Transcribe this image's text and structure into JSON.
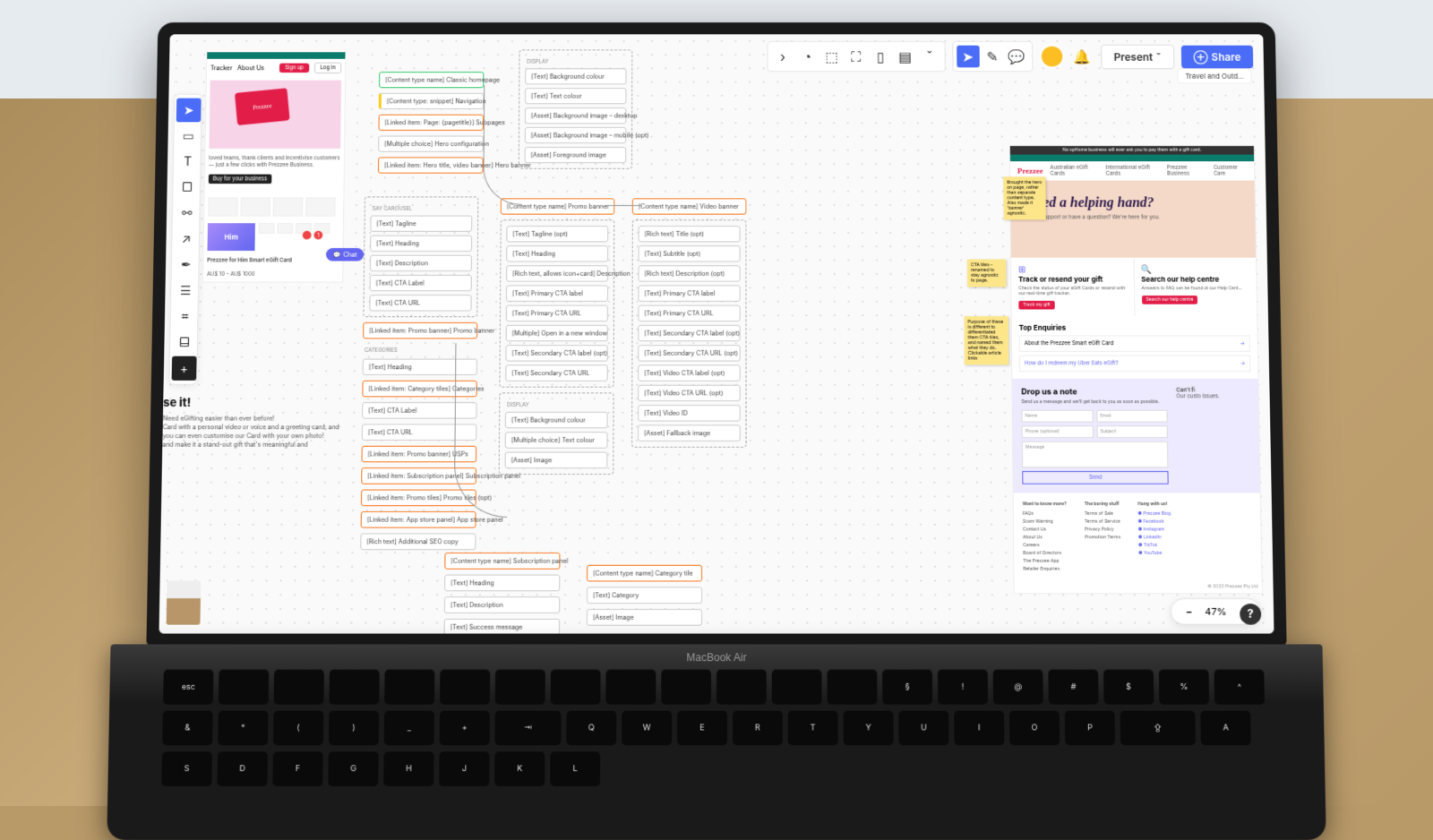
{
  "topbar": {
    "present": "Present",
    "share": "Share"
  },
  "breadcrumb": "Travel and Outd...",
  "zoom": "47%",
  "leftMockup": {
    "tracker": "Tracker",
    "aboutUs": "About Us",
    "signup": "Sign up",
    "login": "Log in",
    "logoText": "Prezzee",
    "heroText": "loved teams, thank clients and incentivise customers — just a few clicks with Prezzee Business.",
    "heroCTA": "Buy for your business",
    "prodTitle": "Prezzee for Him Smart eGift Card",
    "prodPrice": "AU$ 10 – AU$ 1000",
    "him": "Him",
    "chat": "Chat"
  },
  "giftBlock": {
    "heading": "se it!",
    "body1": "Need eGifting easier than ever before!",
    "body2": "Card with a personal video or voice and a greeting card, and you can even customise our Card with your own photo!",
    "body3": "and make it a stand-out gift that's meaningful and"
  },
  "c1": {
    "classic": "[Content type name] Classic homepage",
    "nav": "[Content type: snippet] Navigation",
    "subpages": "[Linked item: Page: {pagetitle}] Subpages",
    "heroConf": "[Multiple choice] Hero configuration",
    "heroBanner": "[Linked item: Hero title, video banner] Hero banner"
  },
  "c2": {
    "carousel": "SAY CAROUSEL",
    "tagline": "[Text] Tagline",
    "heading": "[Text] Heading",
    "desc": "[Text] Description",
    "ctaLabel": "[Text] CTA Label",
    "ctaUrl": "[Text] CTA URL",
    "promoBanner": "[Linked item: Promo banner] Promo banner",
    "categories": "CATEGORIES",
    "heading2": "[Text] Heading",
    "catTiles": "[Linked item: Category tiles] Categories",
    "ctaLabel2": "[Text] CTA Label",
    "ctaUrl2": "[Text] CTA URL",
    "usps": "[Linked item: Promo banner] USPs",
    "subPanel": "[Linked item: Subscription panel] Subscription panel",
    "promoTiles": "[Linked item: Promo tiles] Promo tiles (opt)",
    "appStore": "[Linked item: App store panel] App store panel",
    "seo": "[Rich text] Additional SEO copy"
  },
  "c3": {
    "display": "DISPLAY",
    "bgColor": "[Text] Background colour",
    "textColor": "[Text] Text colour",
    "bgDesktop": "[Asset] Background image – desktop",
    "bgMobile": "[Asset] Background image – mobile (opt)",
    "fgImage": "[Asset] Foreground image",
    "promoBanner": "[Content type name] Promo banner",
    "tagline": "[Text] Tagline (opt)",
    "heading": "[Text] Heading",
    "desc": "[Rich text, allows icon+card] Description",
    "primaryCtaLabel": "[Text] Primary CTA label",
    "primaryCtaUrl": "[Text] Primary CTA URL",
    "newWindow": "[Multiple] Open in a new window",
    "secCtaLabel": "[Text] Secondary CTA label (opt)",
    "secCtaUrl": "[Text] Secondary CTA URL",
    "display2": "DISPLAY",
    "bgColor2": "[Text] Background colour",
    "textColor2": "[Multiple choice] Text colour",
    "image": "[Asset] Image",
    "subPanel": "[Content type name] Subscription panel",
    "heading2": "[Text] Heading",
    "desc2": "[Text] Description",
    "success": "[Text] Success message"
  },
  "c4": {
    "videoBanner": "[Content type name] Video banner",
    "title": "[Rich text] Title (opt)",
    "subtitle": "[Text] Subtitle (opt)",
    "desc": "[Rich text] Description (opt)",
    "primaryCtaLabel": "[Text] Primary CTA label",
    "primaryCtaUrl": "[Text] Primary CTA URL",
    "secCtaLabel": "[Text] Secondary CTA label (opt)",
    "secCtaUrl": "[Text] Secondary CTA URL (opt)",
    "videoCtaLabel": "[Text] Video CTA label (opt)",
    "videoCtaUrl": "[Text] Video CTA URL (opt)",
    "videoId": "[Text] Video ID",
    "fallback": "[Asset] Fallback image",
    "catTile": "[Content type name] Category tile",
    "category": "[Text] Category",
    "image": "[Asset] Image"
  },
  "rightMockup": {
    "announce": "No spHome business will ever ask you to pay them with a gift card.",
    "logo": "Prezzee",
    "nav1": "Australian eGift Cards",
    "nav2": "International eGift Cards",
    "nav3": "Prezzee Business",
    "nav4": "Customer Care",
    "heroH": "Need a helping hand?",
    "heroP": "Need support or have a question? We're here for you.",
    "sticky1": "Brought the hero on page, rather than separate content type. Also made it 'banner' agnostic.",
    "sticky2": "CTA tiles – renamed to stay agnostic to page.",
    "sticky3": "Purpose of these is different to differentiated them CTA tiles, and named them what they do. Clickable article links",
    "tile1H": "Track or resend your gift",
    "tile1P": "Check the status of your eGift Cards or resend with our real-time gift tracker.",
    "tile1Btn": "Track my gift",
    "tile2H": "Search our help centre",
    "tile2P": "Answers to FAQ can be found at our Help Cent...",
    "tile2Btn": "Search our help centre",
    "enqH": "Top Enquiries",
    "faq1": "About the Prezzee Smart eGift Card",
    "faq2": "How do I redeem my Uber Eats eGift?",
    "formH": "Drop us a note",
    "formP": "Send us a message and we'll get back to you as soon as possible.",
    "name": "Name",
    "email": "Email",
    "phone": "Phone (optional)",
    "subject": "Subject",
    "message": "Message",
    "send": "Send",
    "contactH": "Can't fi",
    "contactP": "Our custo issues.",
    "f1h": "Want to know more?",
    "f1a": "FAQs",
    "f1b": "Scam Warning",
    "f1c": "Contact Us",
    "f1d": "About Us",
    "f1e": "Careers",
    "f1f": "Board of Directors",
    "f1g": "The Prezzee App",
    "f1h2": "Retailer Enquiries",
    "f2h": "The boring stuff",
    "f2a": "Terms of Sale",
    "f2b": "Terms of Service",
    "f2c": "Privacy Policy",
    "f2d": "Promotion Terms",
    "f3h": "Hang with us!",
    "f3a": "Prezzee Blog",
    "f3b": "Facebook",
    "f3c": "Instagram",
    "f3d": "LinkedIn",
    "f3e": "TikTok",
    "f3f": "YouTube",
    "copy": "© 2023 Prezzee Pty Ltd"
  }
}
